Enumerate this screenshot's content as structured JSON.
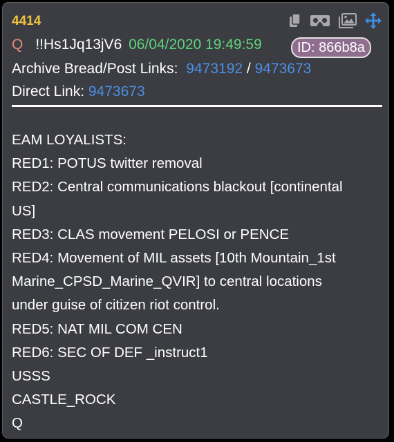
{
  "post": {
    "number": "4414",
    "author_name": "Q",
    "tripcode": "!!Hs1Jq13jV6",
    "datetime": "06/04/2020 19:49:59",
    "id_badge": "ID: 866b8a",
    "archive_label": "Archive Bread/Post Links:",
    "archive_link_1": "9473192",
    "archive_separator": "/",
    "archive_link_2": "9473673",
    "direct_label": "Direct Link:",
    "direct_link": "9473673"
  },
  "toolbar": {
    "icons": [
      "copy-icon",
      "vr-headset-icon",
      "image-gallery-icon",
      "move-arrows-icon"
    ]
  },
  "body": {
    "lines": [
      "EAM LOYALISTS:",
      "RED1: POTUS twitter removal",
      "RED2: Central communications blackout [continental",
      "US]",
      "RED3: CLAS movement PELOSI or PENCE",
      "RED4: Movement of MIL assets [10th Mountain_1st",
      "Marine_CPSD_Marine_QVIR] to central locations",
      "under guise of citizen riot control.",
      "RED5: NAT MIL COM CEN",
      "RED6: SEC OF DEF _instruct1",
      "USSS",
      "CASTLE_ROCK",
      "Q"
    ]
  },
  "colors": {
    "card_bg": "#3c3d42",
    "post_number": "#f0c13f",
    "author": "#e8897a",
    "date": "#5fd47a",
    "link": "#4b8fe6",
    "id_badge_bg": "#8f6d8e",
    "move_icon": "#3d8ee6",
    "toolbar_icon": "#a9a9ad"
  }
}
